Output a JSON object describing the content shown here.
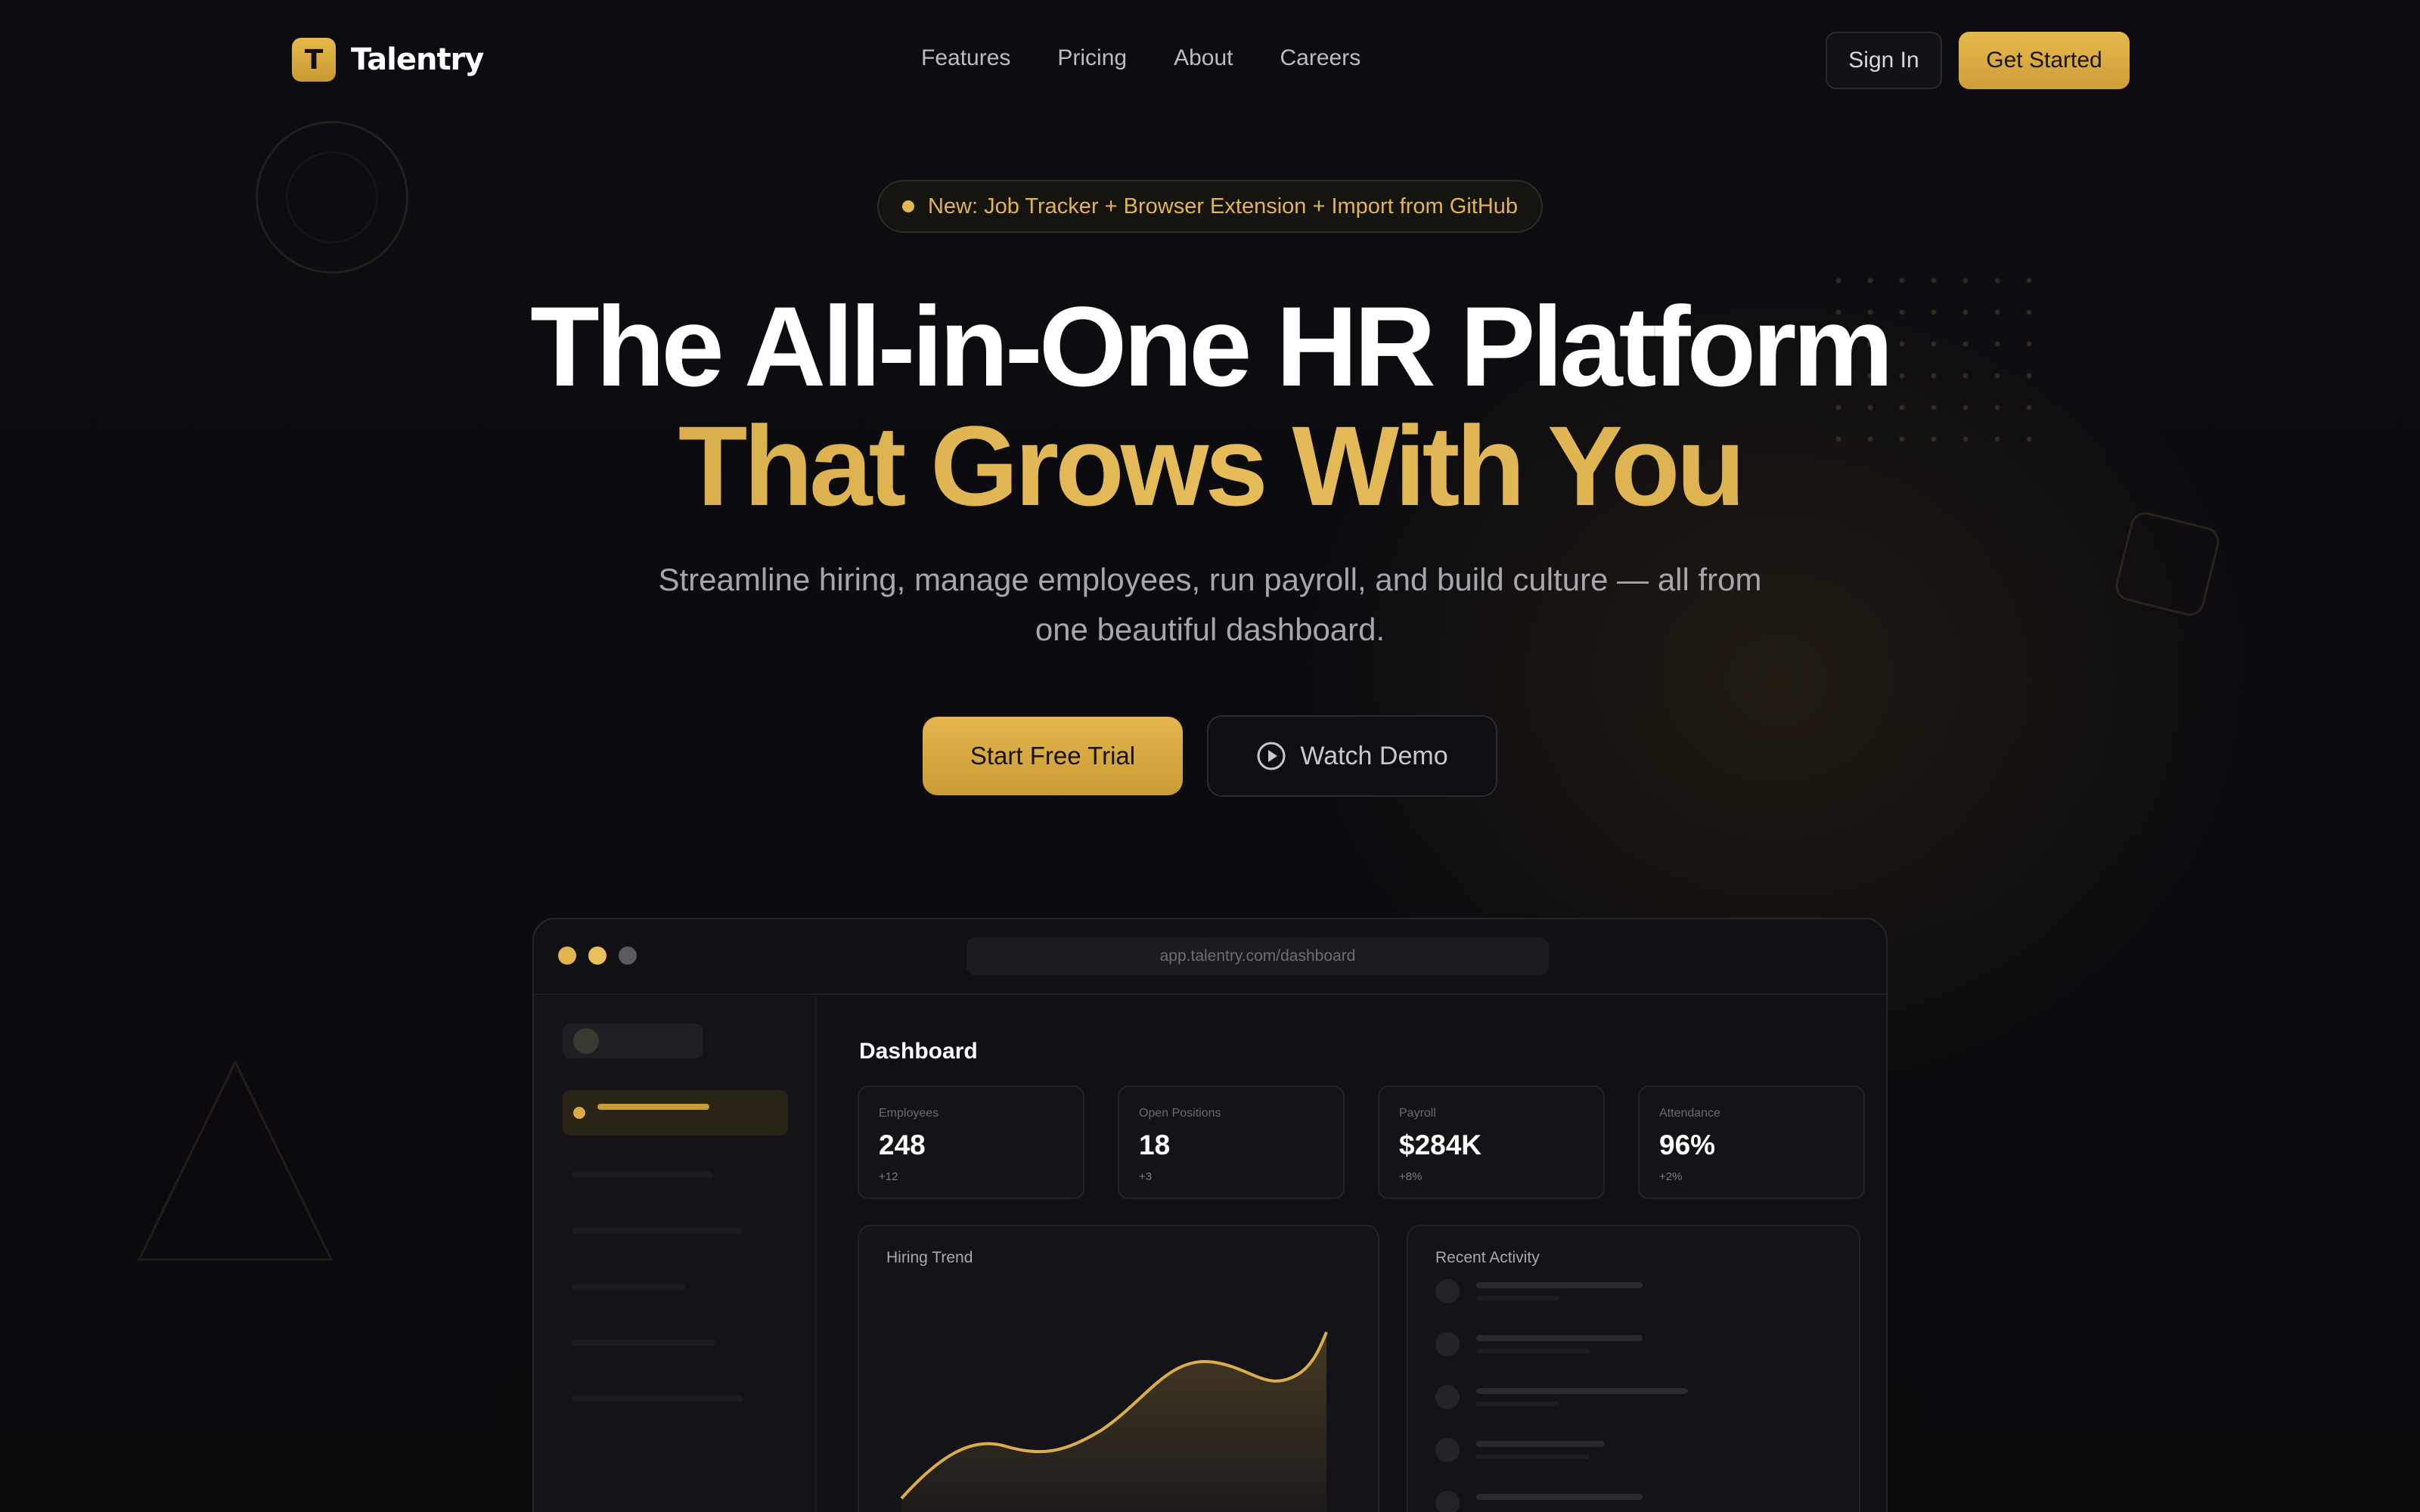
{
  "brand": {
    "logo_letter": "T",
    "name": "Talentry",
    "accent": "#dcae4b"
  },
  "nav": {
    "links": [
      "Features",
      "Pricing",
      "About",
      "Careers"
    ],
    "sign_in": "Sign In",
    "get_started": "Get Started"
  },
  "hero": {
    "badge": "New: Job Tracker + Browser Extension + Import from GitHub",
    "headline_line1": "The All-in-One HR Platform",
    "headline_line2": "That Grows With You",
    "subtitle": "Streamline hiring, manage employees, run payroll, and build culture — all from one beautiful dashboard.",
    "cta_primary": "Start Free Trial",
    "cta_secondary": "Watch Demo",
    "cta_secondary_icon": "play-circle-icon"
  },
  "dashboard_preview": {
    "url": "app.talentry.com/dashboard",
    "title": "Dashboard",
    "stats": [
      {
        "label": "Employees",
        "value": "248",
        "delta": "+12"
      },
      {
        "label": "Open Positions",
        "value": "18",
        "delta": "+3"
      },
      {
        "label": "Payroll",
        "value": "$284K",
        "delta": "+8%"
      },
      {
        "label": "Attendance",
        "value": "96%",
        "delta": "+2%"
      }
    ],
    "panels": {
      "hiring_trend": "Hiring Trend",
      "recent_activity": "Recent Activity"
    }
  }
}
